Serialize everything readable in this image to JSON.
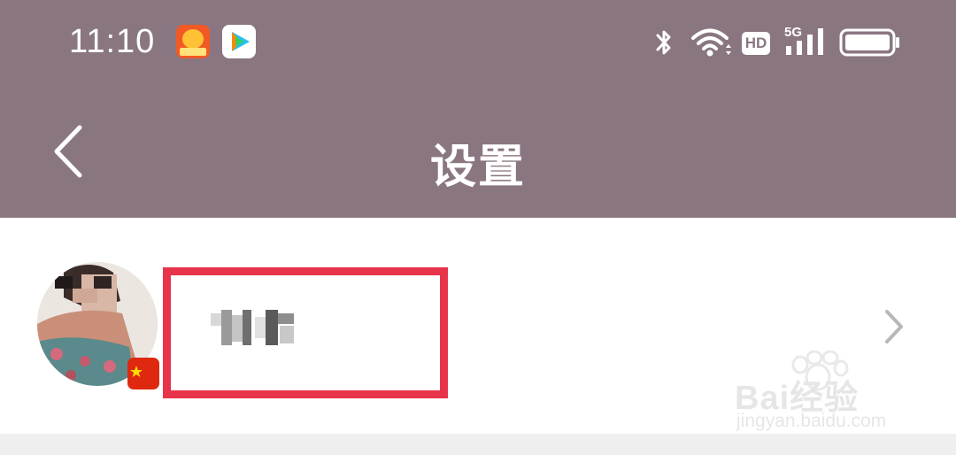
{
  "status_bar": {
    "time": "11:10",
    "notification_icons": [
      "lottery-app-icon",
      "video-app-icon"
    ],
    "system_icons": [
      "bluetooth-icon",
      "wifi-icon",
      "hd-icon",
      "5g-signal-icon",
      "battery-icon"
    ],
    "hd_label": "HD",
    "network_label": "5G"
  },
  "nav": {
    "title": "设置",
    "back_icon": "chevron-left-icon"
  },
  "profile": {
    "avatar": "user-avatar",
    "badge_icon": "china-flag-icon",
    "username_blurred": true,
    "chevron_icon": "chevron-right-icon"
  },
  "watermark": {
    "brand": "Bai经验",
    "url": "jingyan.baidu.com"
  },
  "colors": {
    "header_bg": "#8a7681",
    "highlight_border": "#e8344a",
    "chevron": "#b8b8b8",
    "divider_bg": "#efefef"
  }
}
